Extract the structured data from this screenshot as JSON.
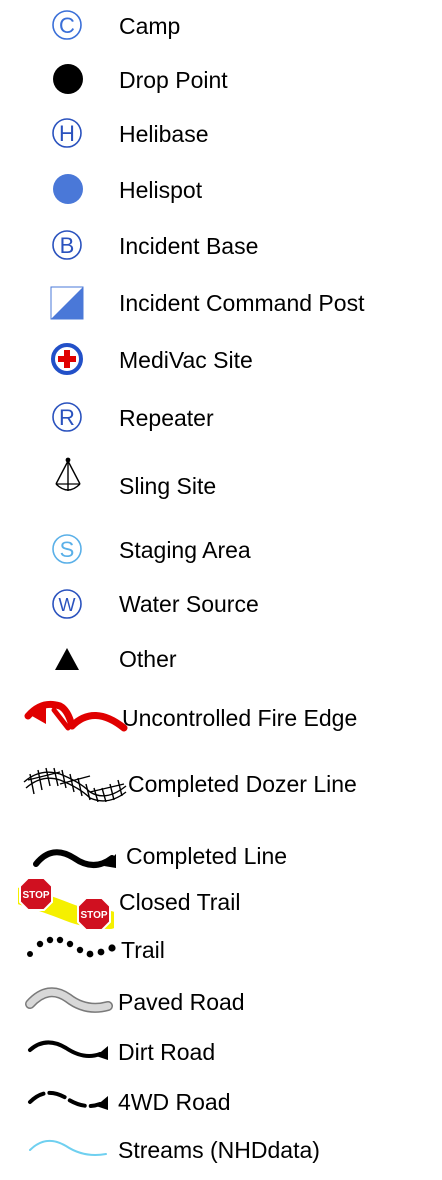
{
  "legend": {
    "items": [
      {
        "label": "Camp",
        "icon": "circle-c-icon",
        "color": "#3a6fd8"
      },
      {
        "label": "Drop Point",
        "icon": "black-dot-icon",
        "color": "#000000"
      },
      {
        "label": "Helibase",
        "icon": "circle-h-icon",
        "color": "#2a52be"
      },
      {
        "label": "Helispot",
        "icon": "blue-dot-icon",
        "color": "#4a78d8"
      },
      {
        "label": "Incident Base",
        "icon": "circle-b-icon",
        "color": "#2a52be"
      },
      {
        "label": "Incident Command Post",
        "icon": "command-post-icon",
        "color": "#4a78d8"
      },
      {
        "label": "MediVac Site",
        "icon": "medivac-cross-icon",
        "color": "#2250c8"
      },
      {
        "label": "Repeater",
        "icon": "circle-r-icon",
        "color": "#2a52be"
      },
      {
        "label": "Sling Site",
        "icon": "sling-site-icon",
        "color": "#000000"
      },
      {
        "label": "Staging Area",
        "icon": "circle-s-icon",
        "color": "#5ab0e8"
      },
      {
        "label": "Water Source",
        "icon": "circle-w-icon",
        "color": "#2a52be"
      },
      {
        "label": "Other",
        "icon": "black-triangle-icon",
        "color": "#000000"
      },
      {
        "label": "Uncontrolled Fire Edge",
        "icon": "fire-edge-line-icon",
        "color": "#e00000"
      },
      {
        "label": "Completed Dozer Line",
        "icon": "dozer-line-icon",
        "color": "#000000"
      },
      {
        "label": "Completed Line",
        "icon": "completed-line-icon",
        "color": "#000000"
      },
      {
        "label": "Closed Trail",
        "icon": "closed-trail-icon",
        "color": "#d01020",
        "sign_text": "STOP"
      },
      {
        "label": "Trail",
        "icon": "trail-dots-icon",
        "color": "#000000"
      },
      {
        "label": "Paved Road",
        "icon": "paved-road-icon",
        "color": "#d8d8d8"
      },
      {
        "label": "Dirt Road",
        "icon": "dirt-road-icon",
        "color": "#000000"
      },
      {
        "label": "4WD Road",
        "icon": "4wd-road-icon",
        "color": "#000000"
      },
      {
        "label": "Streams (NHDdata)",
        "icon": "stream-line-icon",
        "color": "#6fd0f0"
      }
    ]
  }
}
